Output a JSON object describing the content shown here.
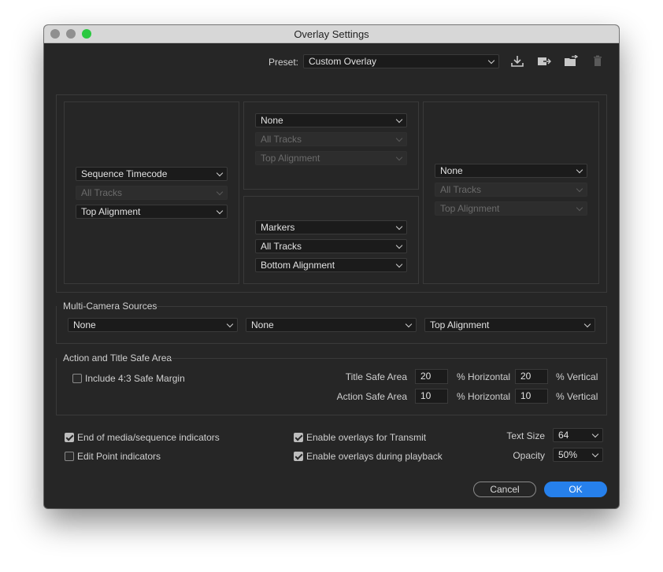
{
  "window": {
    "title": "Overlay Settings"
  },
  "preset": {
    "label": "Preset:",
    "value": "Custom Overlay"
  },
  "icons": [
    "save-preset-icon",
    "import-preset-icon",
    "export-preset-icon",
    "delete-preset-icon"
  ],
  "overlay_grid": {
    "left": {
      "type": "Sequence Timecode",
      "tracks": "All Tracks",
      "alignment": "Top Alignment"
    },
    "center_top": {
      "type": "None",
      "tracks": "All Tracks",
      "alignment": "Top Alignment"
    },
    "center_bottom": {
      "type": "Markers",
      "tracks": "All Tracks",
      "alignment": "Bottom Alignment"
    },
    "right": {
      "type": "None",
      "tracks": "All Tracks",
      "alignment": "Top Alignment"
    }
  },
  "multicam": {
    "heading": "Multi-Camera Sources",
    "source1": "None",
    "source2": "None",
    "alignment": "Top Alignment"
  },
  "safe_area": {
    "heading": "Action and Title Safe Area",
    "include_43": {
      "label": "Include 4:3 Safe Margin",
      "checked": false
    },
    "title_label": "Title Safe Area",
    "title_h": "20",
    "title_v": "20",
    "action_label": "Action Safe Area",
    "action_h": "10",
    "action_v": "10",
    "pct_horizontal": "% Horizontal",
    "pct_vertical": "% Vertical"
  },
  "options": {
    "end_of_media": {
      "label": "End of media/sequence indicators",
      "checked": true
    },
    "edit_point": {
      "label": "Edit Point indicators",
      "checked": false
    },
    "transmit": {
      "label": "Enable overlays for Transmit",
      "checked": true
    },
    "playback": {
      "label": "Enable overlays during playback",
      "checked": true
    },
    "text_size_label": "Text Size",
    "text_size": "64",
    "opacity_label": "Opacity",
    "opacity": "50%"
  },
  "buttons": {
    "cancel": "Cancel",
    "ok": "OK"
  },
  "colors": {
    "accent": "#2680eb",
    "background": "#262626",
    "control": "#1b1b1b"
  }
}
